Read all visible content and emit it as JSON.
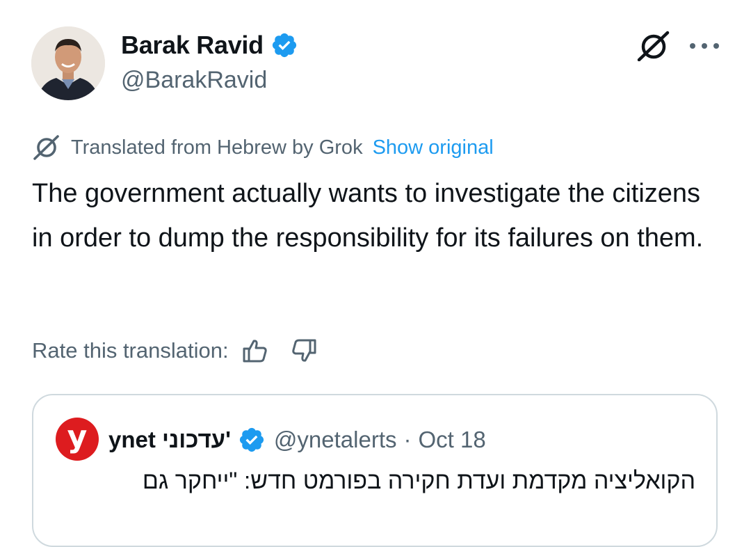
{
  "author": {
    "display_name": "Barak Ravid",
    "handle": "@BarakRavid",
    "verified": true
  },
  "translation": {
    "notice": "Translated from Hebrew by Grok",
    "show_original": "Show original",
    "text": "The government actually wants to investigate the citizens in order to dump the responsibility for its failures on them."
  },
  "rating": {
    "label": "Rate this translation:"
  },
  "quote": {
    "avatar_letter": "y",
    "display_name": "ynet עדכוני'",
    "handle": "@ynetalerts",
    "separator": "·",
    "date": "Oct 18",
    "text": "הקואליציה מקדמת ועדת חקירה בפורמט חדש: \"ייחקר גם"
  },
  "icons": {
    "grok": "grok-icon",
    "more": "more-options-icon",
    "verified": "verified-badge-icon",
    "thumb_up": "thumbs-up-icon",
    "thumb_down": "thumbs-down-icon"
  },
  "colors": {
    "text_primary": "#0f1419",
    "text_secondary": "#536471",
    "link": "#1d9bf0",
    "verified": "#1d9bf0",
    "ynet_red": "#dd1c1f",
    "card_border": "#cfd9de"
  }
}
